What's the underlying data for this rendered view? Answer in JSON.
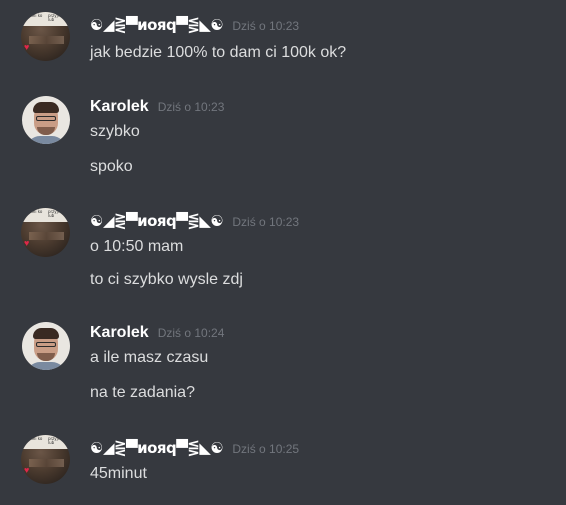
{
  "messages": [
    {
      "author": "☯◢⋛▀иояq▀⋚◣☯",
      "timestamp": "Dziś o 10:23",
      "avatar": {
        "caption_left": "Jeżeli ko",
        "caption_right": "przyjmie lub",
        "icon": "heart-icon"
      },
      "lines": [
        "jak bedzie 100% to dam ci 100k ok?"
      ]
    },
    {
      "author": "Karolek",
      "timestamp": "Dziś o 10:23",
      "lines": [
        "szybko",
        "spoko"
      ]
    },
    {
      "author": "☯◢⋛▀иояq▀⋚◣☯",
      "timestamp": "Dziś o 10:23",
      "avatar": {
        "caption_left": "Jeżeli ko",
        "caption_right": "przyjmie lub",
        "icon": "heart-icon"
      },
      "lines": [
        "o 10:50 mam",
        "to ci szybko wysle zdj"
      ]
    },
    {
      "author": "Karolek",
      "timestamp": "Dziś o 10:24",
      "lines": [
        "a ile masz czasu",
        "na te zadania?"
      ]
    },
    {
      "author": "☯◢⋛▀иояq▀⋚◣☯",
      "timestamp": "Dziś o 10:25",
      "avatar": {
        "caption_left": "Jeżeli ko",
        "caption_right": "przyjmie lub",
        "icon": "heart-icon"
      },
      "lines": [
        "45minut"
      ]
    }
  ],
  "colors": {
    "background": "#36393f",
    "username": "#ffffff",
    "timestamp": "#72767d",
    "message_text": "#dcddde",
    "heart": "#e0274a"
  }
}
